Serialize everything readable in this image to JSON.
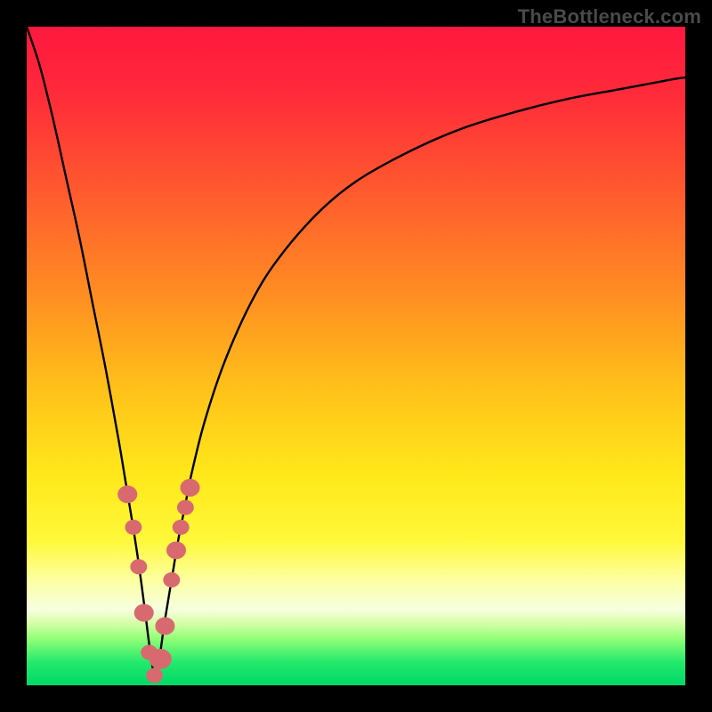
{
  "watermark": {
    "text": "TheBottleneck.com"
  },
  "colors": {
    "frame": "#000000",
    "curve": "#000000",
    "marker_fill": "#d86a6f",
    "marker_stroke": "#c45158",
    "gradient_stops": [
      {
        "offset": 0.0,
        "color": "#ff183f"
      },
      {
        "offset": 0.1,
        "color": "#ff2a3a"
      },
      {
        "offset": 0.25,
        "color": "#ff5a2e"
      },
      {
        "offset": 0.4,
        "color": "#ff8b22"
      },
      {
        "offset": 0.55,
        "color": "#ffc11a"
      },
      {
        "offset": 0.68,
        "color": "#ffe81a"
      },
      {
        "offset": 0.78,
        "color": "#fff83a"
      },
      {
        "offset": 0.84,
        "color": "#fdffa0"
      },
      {
        "offset": 0.885,
        "color": "#f6ffe0"
      },
      {
        "offset": 0.905,
        "color": "#d8ffa8"
      },
      {
        "offset": 0.93,
        "color": "#8fff77"
      },
      {
        "offset": 0.965,
        "color": "#23e96b"
      },
      {
        "offset": 1.0,
        "color": "#00d968"
      }
    ]
  },
  "chart_data": {
    "type": "line",
    "title": "",
    "xlabel": "",
    "ylabel": "",
    "x_range": [
      0,
      100
    ],
    "y_range": [
      0,
      100
    ],
    "notes": "Bottleneck-style V-curve. x is a normalized balance axis (0–100), y is percentage bottleneck (0 at bottom = no bottleneck, 100 at top = full bottleneck). Curve minimum ≈ x 19.5. Values estimated from pixels.",
    "series": [
      {
        "name": "bottleneck_curve",
        "x": [
          0,
          2,
          4,
          6,
          8,
          10,
          12,
          14,
          15,
          16,
          17,
          18,
          18.5,
          19,
          19.5,
          20,
          20.5,
          21,
          22,
          23,
          24,
          25,
          27,
          30,
          34,
          38,
          44,
          50,
          58,
          66,
          74,
          82,
          90,
          98,
          100
        ],
        "y": [
          100,
          94,
          86,
          77,
          68,
          58,
          48,
          37,
          31,
          25,
          18.5,
          11,
          7,
          3.5,
          1,
          3,
          6.5,
          10,
          16,
          22,
          27,
          32,
          40,
          49,
          58,
          64.5,
          71.5,
          76.5,
          81,
          84.5,
          87,
          89,
          90.5,
          92,
          92.3
        ]
      }
    ],
    "markers": {
      "name": "highlighted_points",
      "x": [
        15.3,
        16.2,
        17.0,
        17.8,
        18.6,
        19.4,
        20.3,
        21.0,
        22.0,
        22.7,
        23.4,
        24.1,
        24.8
      ],
      "y": [
        29.0,
        24.0,
        18.0,
        11.0,
        5.0,
        1.5,
        4.0,
        9.0,
        16.0,
        20.5,
        24.0,
        27.0,
        30.0
      ]
    }
  }
}
